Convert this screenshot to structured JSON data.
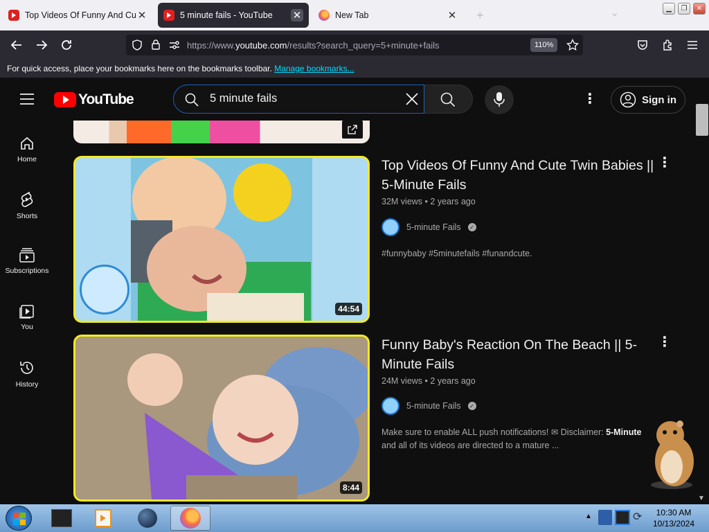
{
  "browser": {
    "tabs": [
      {
        "title": "Top Videos Of Funny And Cute Twin Babies",
        "favicon": "youtube-icon",
        "active": false
      },
      {
        "title": "5 minute fails - YouTube",
        "favicon": "youtube-icon",
        "active": true
      },
      {
        "title": "New Tab",
        "favicon": "firefox-icon",
        "active": false
      }
    ],
    "url_prefix": "https://www.",
    "url_domain": "youtube.com",
    "url_path": "/results?search_query=5+minute+fails",
    "zoom": "110%",
    "bookmarks_text": "For quick access, place your bookmarks here on the bookmarks toolbar.",
    "bookmarks_link": "Manage bookmarks..."
  },
  "youtube": {
    "logo_text": "YouTube",
    "search_value": "5 minute fails",
    "signin_label": "Sign in",
    "sidebar": [
      {
        "label": "Home",
        "icon": "home-icon"
      },
      {
        "label": "Shorts",
        "icon": "shorts-icon"
      },
      {
        "label": "Subscriptions",
        "icon": "subscriptions-icon"
      },
      {
        "label": "You",
        "icon": "you-icon"
      },
      {
        "label": "History",
        "icon": "history-icon"
      }
    ],
    "results": [
      {
        "title": "Top Videos Of Funny And Cute Twin Babies || 5-Minute Fails",
        "views": "32M views",
        "age": "2 years ago",
        "channel": "5-minute Fails",
        "description": "#funnybaby #5minutefails #funandcute.",
        "duration": "44:54"
      },
      {
        "title": "Funny Baby's Reaction On The Beach || 5-Minute Fails",
        "views": "24M views",
        "age": "2 years ago",
        "channel": "5-minute Fails",
        "description_pre": "Make sure to enable ALL push notifications! ✉ Disclaimer: ",
        "description_bold": "5-Minute",
        "description_post": "and all of its videos are directed to a mature ...",
        "duration": "8:44"
      }
    ]
  },
  "taskbar": {
    "time": "10:30 AM",
    "date": "10/13/2024"
  },
  "colors": {
    "accent_yellow": "#f2ea20",
    "youtube_red": "#ff0000",
    "bg": "#0f0f0f"
  }
}
